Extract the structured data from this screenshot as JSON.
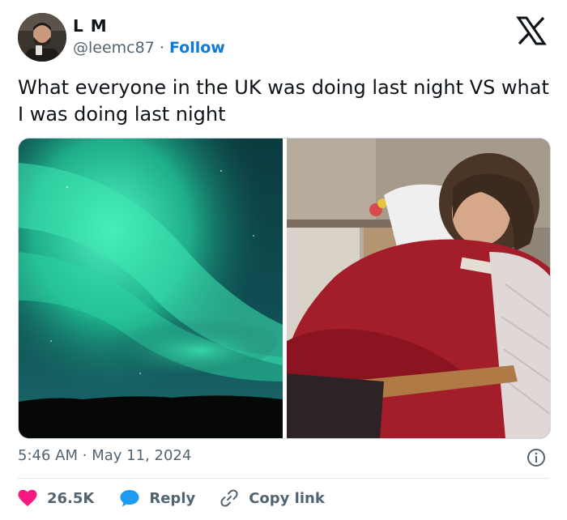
{
  "author": {
    "name": "L M",
    "handle": "@leemc87",
    "separator": "·",
    "follow_label": "Follow"
  },
  "brand": {
    "logo": "x-logo-icon"
  },
  "tweet": {
    "text": "What everyone in the UK was doing last night VS what I was doing last night"
  },
  "media": [
    {
      "name": "aurora-photo"
    },
    {
      "name": "sleeping-woman-photo"
    }
  ],
  "meta": {
    "time": "5:46 AM",
    "separator": "·",
    "date": "May 11, 2024"
  },
  "actions": {
    "likes_count": "26.5K",
    "reply_label": "Reply",
    "copy_link_label": "Copy link"
  },
  "colors": {
    "accent": "#0f7ad8",
    "like": "#f91880",
    "reply": "#1d9bf0",
    "muted": "#536471"
  }
}
